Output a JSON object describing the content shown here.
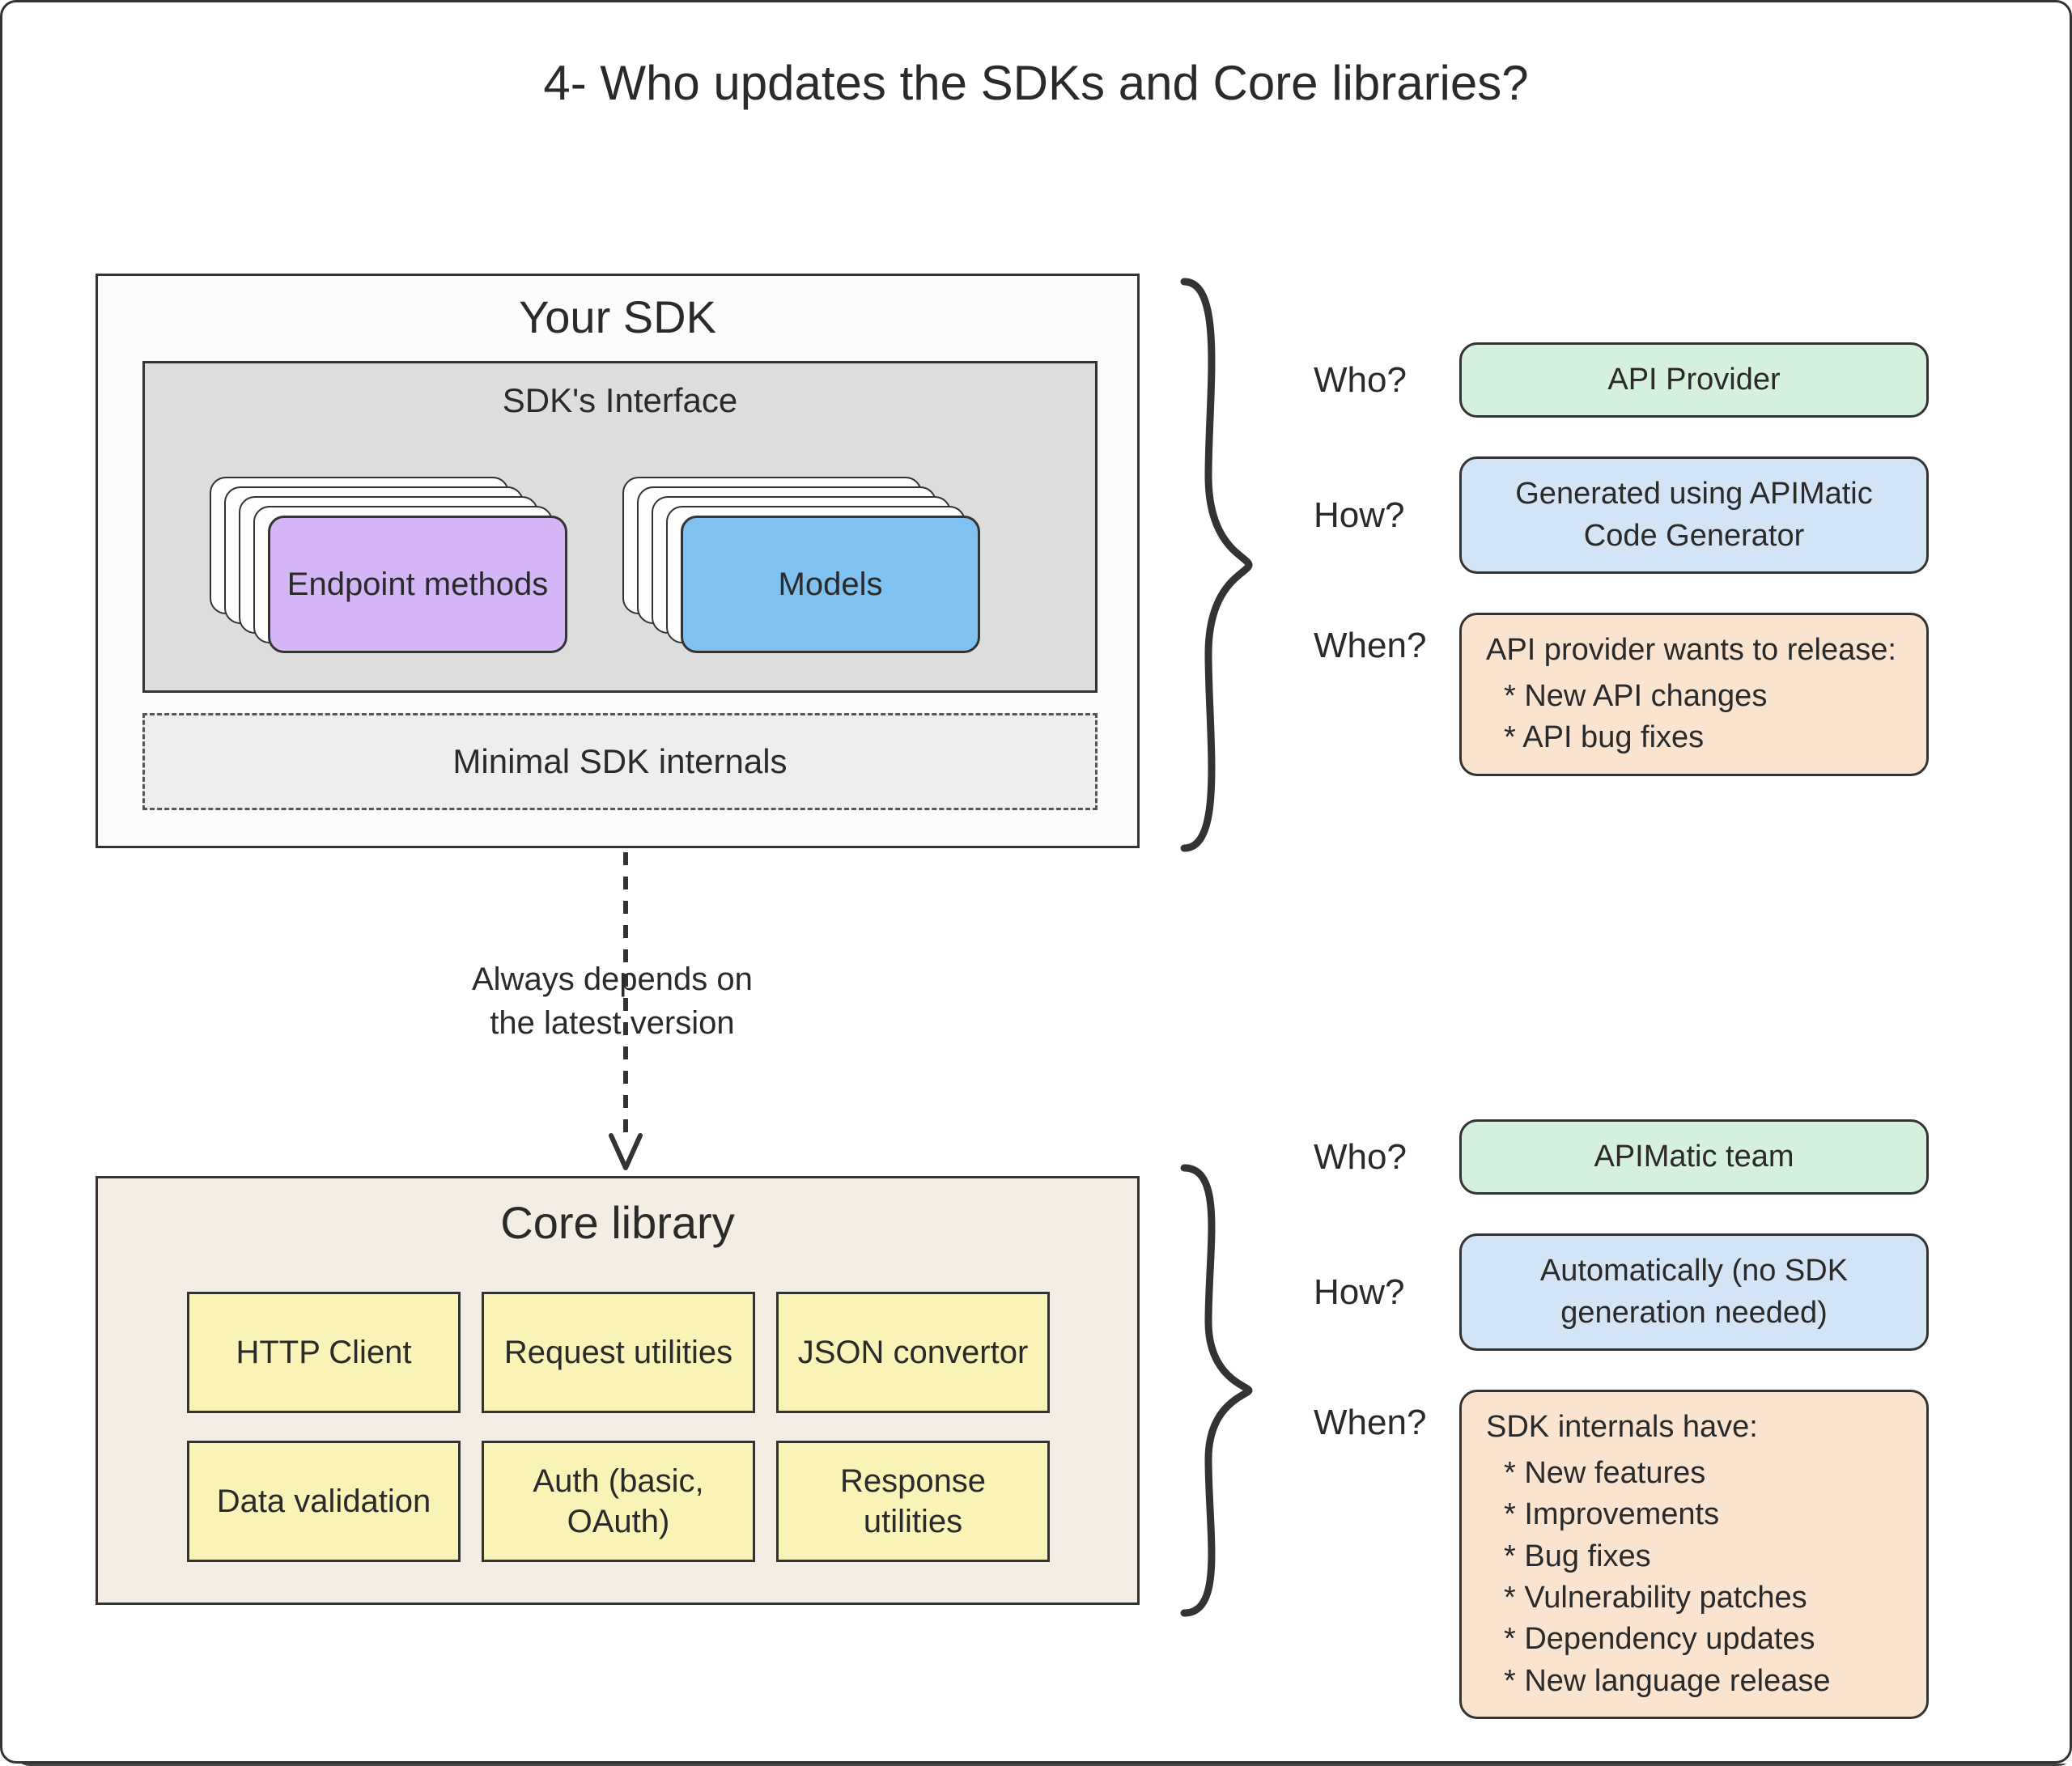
{
  "title": "4- Who updates the SDKs and Core libraries?",
  "sdk": {
    "title": "Your SDK",
    "interface_title": "SDK's Interface",
    "endpoint_label": "Endpoint methods",
    "models_label": "Models",
    "minimal_label": "Minimal SDK internals"
  },
  "depends_label_line1": "Always depends on",
  "depends_label_line2": "the latest version",
  "core": {
    "title": "Core library",
    "cells": [
      "HTTP Client",
      "Request utilities",
      "JSON convertor",
      "Data validation",
      "Auth (basic, OAuth)",
      "Response utilities"
    ]
  },
  "anno_sdk": {
    "who_label": "Who?",
    "who_value": "API Provider",
    "how_label": "How?",
    "how_value": "Generated using APIMatic Code Generator",
    "when_label": "When?",
    "when_lead": "API provider wants to release:",
    "when_items": [
      "New API changes",
      "API bug fixes"
    ]
  },
  "anno_core": {
    "who_label": "Who?",
    "who_value": "APIMatic team",
    "how_label": "How?",
    "how_value": "Automatically (no SDK generation needed)",
    "when_label": "When?",
    "when_lead": "SDK internals have:",
    "when_items": [
      "New features",
      "Improvements",
      "Bug fixes",
      "Vulnerability patches",
      "Dependency updates",
      "New language release"
    ]
  }
}
